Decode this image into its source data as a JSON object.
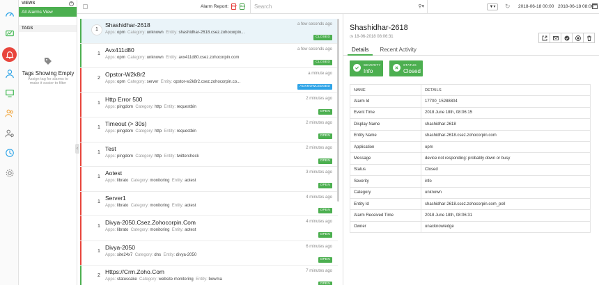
{
  "views": {
    "title": "VIEWS",
    "selected": "All Alarms View",
    "tags_title": "TAGS",
    "empty_title": "Tags Showing Empty",
    "empty_sub": "Assign tag for alarms to make it easier to filter"
  },
  "topbar": {
    "alarm_report": "Alarm Report:",
    "search_placeholder": "Search",
    "date_from": "2018-06-18 00:00",
    "date_to": "2018-06-18 08:06"
  },
  "labels": {
    "apps": "Apps:",
    "category": "Category:",
    "entity": "Entity:"
  },
  "alarms": [
    {
      "title": "Shashidhar-2618",
      "count": "1",
      "app": "opm",
      "category": "unknown",
      "entity": "shashidhar-2618.csez.zohocorpin...",
      "time": "a few seconds ago",
      "status": "CLOSED"
    },
    {
      "title": "Avx411d80",
      "count": "1",
      "app": "opm",
      "category": "unknown",
      "entity": "avx411d80.csez.zohocorpin.com",
      "time": "a few seconds ago",
      "status": "CLOSED"
    },
    {
      "title": "Opstor-W2k8r2",
      "count": "2",
      "app": "opm",
      "category": "server",
      "entity": "opstor-w2k8r2.csez.zohocorpin.co...",
      "time": "a minute ago",
      "status": "ACKNOWLEDGED"
    },
    {
      "title": "Http Error 500",
      "count": "1",
      "app": "pingdom",
      "category": "http",
      "entity": "requestbin",
      "time": "2 minutes ago",
      "status": "OPEN"
    },
    {
      "title": "Timeout (> 30s)",
      "count": "1",
      "app": "pingdom",
      "category": "http",
      "entity": "requestbin",
      "time": "2 minutes ago",
      "status": "OPEN"
    },
    {
      "title": "Test",
      "count": "1",
      "app": "pingdom",
      "category": "http",
      "entity": "twittercheck",
      "time": "2 minutes ago",
      "status": "OPEN"
    },
    {
      "title": "Aotest",
      "count": "1",
      "app": "librato",
      "category": "monitoring",
      "entity": "aotest",
      "time": "3 minutes ago",
      "status": "OPEN"
    },
    {
      "title": "Server1",
      "count": "1",
      "app": "librato",
      "category": "monitoring",
      "entity": "aotest",
      "time": "4 minutes ago",
      "status": "OPEN"
    },
    {
      "title": "Divya-2050.Csez.Zohocorpin.Com",
      "count": "1",
      "app": "librato",
      "category": "monitoring",
      "entity": "aotest",
      "time": "4 minutes ago",
      "status": "OPEN"
    },
    {
      "title": "Divya-2050",
      "count": "1",
      "app": "site24x7",
      "category": "dns",
      "entity": "divya-2050",
      "time": "6 minutes ago",
      "status": "OPEN"
    },
    {
      "title": "Https://Crm.Zoho.Com",
      "count": "2",
      "app": "statuscake",
      "category": "website monitoring",
      "entity": "bowma",
      "time": "7 minutes ago",
      "status": "OPEN"
    }
  ],
  "detail": {
    "title": "Shashidhar-2618",
    "timestamp": "18-06-2018 08:06:31",
    "tabs": [
      "Details",
      "Recent Activity"
    ],
    "severity_label": "SEVERITY",
    "severity_value": "Info",
    "status_label": "STATUS",
    "status_value": "Closed",
    "table_head": [
      "NAME",
      "DETAILS"
    ],
    "rows": [
      [
        "Alarm Id",
        "17700_15288804"
      ],
      [
        "Event Time",
        "2018 June 18th, 08:06:15"
      ],
      [
        "Display Name",
        "shashidhar-2618"
      ],
      [
        "Entity Name",
        "shashidhar-2618.csez.zohocorpin.com"
      ],
      [
        "Application",
        "opm"
      ],
      [
        "Message",
        "device not responding: probably down or busy"
      ],
      [
        "Status",
        "Closed"
      ],
      [
        "Severity",
        "info"
      ],
      [
        "Category",
        "unknown"
      ],
      [
        "Entity Id",
        "shashidhar-2618.csez.zohocorpin.com_poll"
      ],
      [
        "Alarm Received Time",
        "2018 June 18th, 08:06:31"
      ],
      [
        "Owner",
        "unacknowledge"
      ]
    ]
  },
  "colors": {
    "green": "#4caf50",
    "red": "#e8453c",
    "blue": "#2fa4e7",
    "pdf_red": "#e53935",
    "xls_green": "#43a047"
  },
  "icons": [
    "dashboard-icon",
    "alarms-icon",
    "bell-icon",
    "user-icon",
    "monitor-icon",
    "users-icon",
    "settings-users-icon",
    "clock-icon",
    "gear-icon",
    "tag-icon",
    "search-icon",
    "filter-icon",
    "refresh-icon",
    "calendar-icon",
    "open-external-icon",
    "mail-icon",
    "check-circle-icon",
    "record-icon",
    "trash-icon"
  ]
}
